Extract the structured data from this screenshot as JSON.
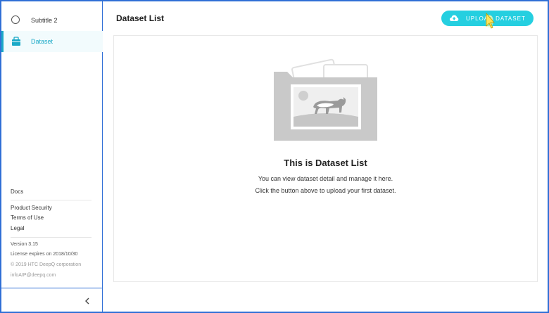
{
  "sidebar": {
    "items": [
      {
        "label": "Subtitle 2",
        "icon": "circle-icon"
      },
      {
        "label": "Dataset",
        "icon": "folder-icon"
      }
    ],
    "docs": "Docs",
    "links": [
      "Product Security",
      "Terms of Use",
      "Legal"
    ],
    "version": "Version 3.15",
    "license": "License expires on 2018/10/30",
    "copyright": "© 2019 HTC DeepQ corporation",
    "email": "infoAIP@deepq.com"
  },
  "header": {
    "title": "Dataset List",
    "upload_label": "UPLOAD DATASET"
  },
  "empty_state": {
    "title": "This is Dataset List",
    "line1": "You can view dataset detail and manage it here.",
    "line2": "Click the button above to upload your first dataset."
  },
  "colors": {
    "accent": "#25cfe0",
    "active": "#1aa9c7",
    "frame": "#2f6fd6"
  }
}
